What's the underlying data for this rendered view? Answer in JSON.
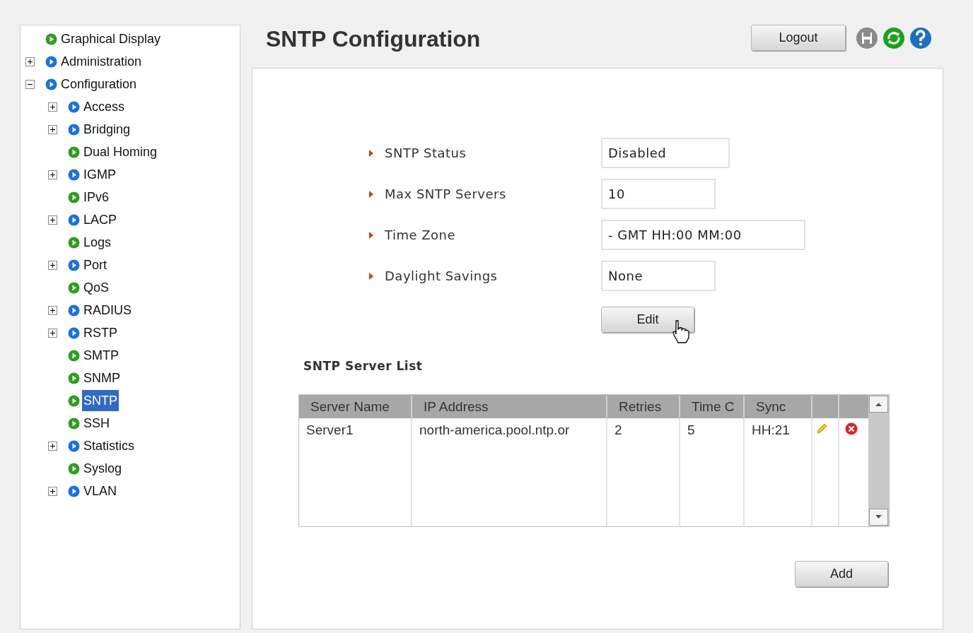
{
  "sidebar": {
    "tree": [
      {
        "label": "Graphical Display",
        "kind": "page",
        "selected": false
      },
      {
        "label": "Administration",
        "kind": "folder",
        "expanded": false,
        "selected": false
      },
      {
        "label": "Configuration",
        "kind": "folder",
        "expanded": true,
        "selected": false,
        "children": [
          {
            "label": "Access",
            "kind": "folder",
            "expanded": false,
            "selected": false
          },
          {
            "label": "Bridging",
            "kind": "folder",
            "expanded": false,
            "selected": false
          },
          {
            "label": "Dual Homing",
            "kind": "page",
            "selected": false
          },
          {
            "label": "IGMP",
            "kind": "folder",
            "expanded": false,
            "selected": false
          },
          {
            "label": "IPv6",
            "kind": "page",
            "selected": false
          },
          {
            "label": "LACP",
            "kind": "folder",
            "expanded": false,
            "selected": false
          },
          {
            "label": "Logs",
            "kind": "page",
            "selected": false
          },
          {
            "label": "Port",
            "kind": "folder",
            "expanded": false,
            "selected": false
          },
          {
            "label": "QoS",
            "kind": "page",
            "selected": false
          },
          {
            "label": "RADIUS",
            "kind": "folder",
            "expanded": false,
            "selected": false
          },
          {
            "label": "RSTP",
            "kind": "folder",
            "expanded": false,
            "selected": false
          },
          {
            "label": "SMTP",
            "kind": "page",
            "selected": false
          },
          {
            "label": "SNMP",
            "kind": "page",
            "selected": false
          },
          {
            "label": "SNTP",
            "kind": "page",
            "selected": true
          },
          {
            "label": "SSH",
            "kind": "page",
            "selected": false
          },
          {
            "label": "Statistics",
            "kind": "folder",
            "expanded": false,
            "selected": false
          },
          {
            "label": "Syslog",
            "kind": "page",
            "selected": false
          },
          {
            "label": "VLAN",
            "kind": "folder",
            "expanded": false,
            "selected": false
          }
        ]
      }
    ]
  },
  "page": {
    "title": "SNTP Configuration",
    "logout_button": "Logout"
  },
  "settings": [
    {
      "label": "SNTP Status",
      "value": "Disabled"
    },
    {
      "label": "Max SNTP Servers",
      "value": "10"
    },
    {
      "label": "Time Zone",
      "value": "- GMT HH:00 MM:00"
    },
    {
      "label": "Daylight Savings",
      "value": "None"
    }
  ],
  "edit_button": "Edit",
  "server_list": {
    "title": "SNTP Server List",
    "columns": [
      "Server Name",
      "IP Address",
      "Retries",
      "Time C",
      "Sync"
    ],
    "rows": [
      {
        "cells": [
          "Server1",
          "north-america.pool.ntp.or",
          "2",
          "5",
          "HH:21"
        ]
      }
    ]
  },
  "add_button": "Add"
}
